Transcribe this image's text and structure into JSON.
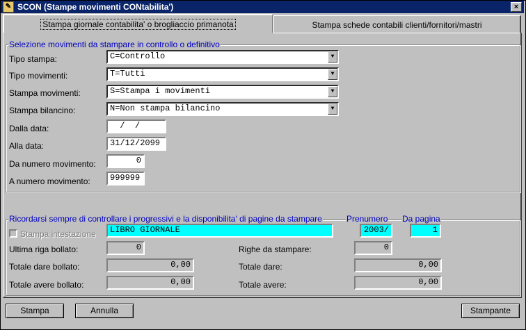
{
  "window": {
    "title": "SCON (Stampe movimenti CONtabilita')",
    "close_glyph": "×"
  },
  "tabs": [
    {
      "label": "Stampa giornale contabilita' o brogliaccio primanota",
      "active": true
    },
    {
      "label": "Stampa schede contabili clienti/fornitori/mastri",
      "active": false
    }
  ],
  "selezione": {
    "legend": "Selezione movimenti da stampare in controllo o definitivo",
    "tipo_stampa": {
      "label": "Tipo stampa:",
      "value": "C=Controllo"
    },
    "tipo_movimenti": {
      "label": "Tipo movimenti:",
      "value": "T=Tutti"
    },
    "stampa_movimenti": {
      "label": "Stampa movimenti:",
      "value": "S=Stampa i movimenti"
    },
    "stampa_bilancino": {
      "label": "Stampa bilancino:",
      "value": "N=Non stampa bilancino"
    },
    "dalla_data": {
      "label": "Dalla data:",
      "value": "  /  /"
    },
    "alla_data": {
      "label": "Alla data:",
      "value": "31/12/2099"
    },
    "da_numero": {
      "label": "Da numero movimento:",
      "value": "0"
    },
    "a_numero": {
      "label": "A numero movimento:",
      "value": "999999"
    }
  },
  "ricordarsi": {
    "legend": "Ricordarsi sempre di controllare i progressivi e la disponibilita' di pagine da stampare",
    "prenumero_label": "Prenumero",
    "da_pagina_label": "Da pagina",
    "intestazione": {
      "label": "Stampa intestazione",
      "value": "LIBRO GIORNALE",
      "checked": false
    },
    "prenumero_value": "2003/",
    "da_pagina_value": "1",
    "ultima_riga": {
      "label": "Ultima riga bollato:",
      "value": "0"
    },
    "righe_da_stampare": {
      "label": "Righe da stampare:",
      "value": "0"
    },
    "totale_dare_bollato": {
      "label": "Totale dare bollato:",
      "value": "0,00"
    },
    "totale_dare": {
      "label": "Totale dare:",
      "value": "0,00"
    },
    "totale_avere_bollato": {
      "label": "Totale avere bollato:",
      "value": "0,00"
    },
    "totale_avere": {
      "label": "Totale avere:",
      "value": "0,00"
    }
  },
  "buttons": {
    "stampa": "Stampa",
    "annulla": "Annulla",
    "stampante": "Stampante"
  },
  "icons": {
    "dropdown": "▼"
  }
}
